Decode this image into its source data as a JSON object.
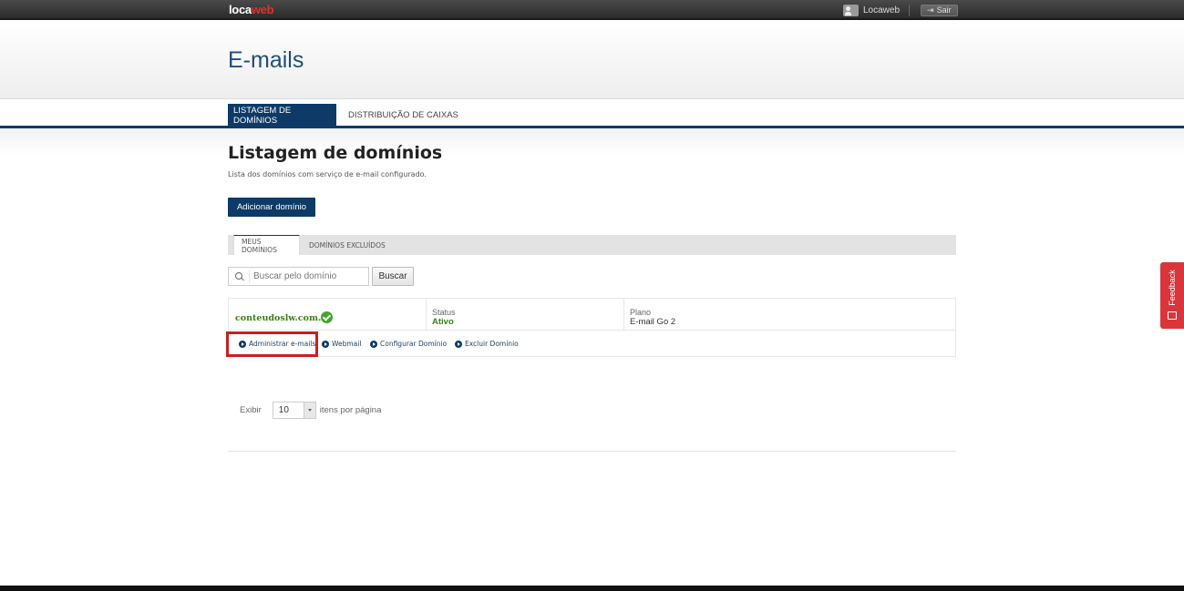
{
  "topbar": {
    "logo_main": "loca",
    "logo_accent": "web",
    "user_name": "Locaweb",
    "logout_label": "Sair",
    "accent_color": "#e0312b"
  },
  "header": {
    "title": "E-mails"
  },
  "nav": {
    "tabs": [
      {
        "label": "LISTAGEM DE DOMÍNIOS",
        "active": true
      },
      {
        "label": "DISTRIBUIÇÃO DE CAIXAS",
        "active": false
      }
    ]
  },
  "main": {
    "title": "Listagem de domínios",
    "subtitle": "Lista dos domínios com serviço de e-mail configurado.",
    "add_button": "Adicionar domínio",
    "subtabs": [
      {
        "label": "MEUS DOMÍNIOS",
        "active": true
      },
      {
        "label": "DOMÍNIOS EXCLUÍDOS",
        "active": false
      }
    ],
    "search": {
      "placeholder": "Buscar pelo domínio",
      "button": "Buscar"
    },
    "domains": [
      {
        "name": "conteudoslw.com.br",
        "status_label": "Status",
        "status_value": "Ativo",
        "plan_label": "Plano",
        "plan_value": "E-mail Go 2",
        "actions": [
          "Administrar e-mails",
          "Webmail",
          "Configurar Domínio",
          "Excluir Domínio"
        ]
      }
    ],
    "pager": {
      "show_label": "Exibir",
      "per_page_value": "10",
      "per_page_suffix": "itens por página"
    }
  },
  "feedback": {
    "label": "Feedback"
  },
  "colors": {
    "brand_dark": "#0d3a66",
    "status_green": "#3a7d1a",
    "highlight": "#cc1f1f",
    "feedback_red": "#d9353a"
  }
}
